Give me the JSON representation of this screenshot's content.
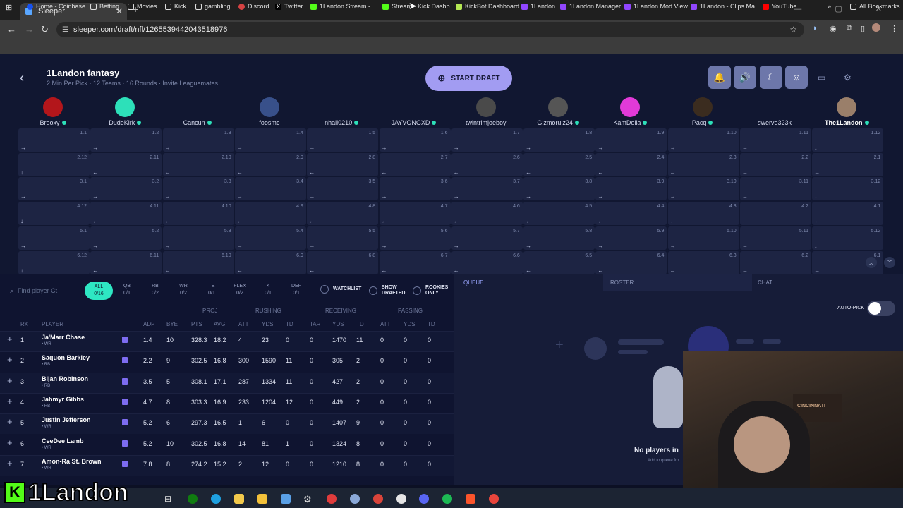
{
  "browser": {
    "tab_title": "Sleeper",
    "url": "sleeper.com/draft/nfl/1265539442043518976",
    "bookmarks": [
      "Home - Coinbase",
      "Betting",
      "Movies",
      "Kick",
      "gambling",
      "Discord",
      "Twitter",
      "1Landon Stream -...",
      "Stream - Kick Dashb...",
      "KickBot Dashboard",
      "1Landon",
      "1Landon Manager",
      "1Landon Mod View",
      "1Landon - Clips Ma...",
      "YouTube"
    ],
    "all_bookmarks": "All Bookmarks"
  },
  "header": {
    "league_name": "1Landon fantasy",
    "league_sub": "2 Min Per Pick · 12 Teams · 16 Rounds · Invite Leaguemates",
    "start_draft": "START DRAFT"
  },
  "teams": [
    "Brooxy",
    "DudeKirk",
    "Cancun",
    "foosmc",
    "nhall0210",
    "JAYVONGXD",
    "twintrimjoeboy",
    "Gizmorulz24",
    "KamDolla",
    "Pacq",
    "swervo323k",
    "The1Landon"
  ],
  "picks": [
    [
      "1.1",
      "1.2",
      "1.3",
      "1.4",
      "1.5",
      "1.6",
      "1.7",
      "1.8",
      "1.9",
      "1.10",
      "1.11",
      "1.12"
    ],
    [
      "2.12",
      "2.11",
      "2.10",
      "2.9",
      "2.8",
      "2.7",
      "2.6",
      "2.5",
      "2.4",
      "2.3",
      "2.2",
      "2.1"
    ],
    [
      "3.1",
      "3.2",
      "3.3",
      "3.4",
      "3.5",
      "3.6",
      "3.7",
      "3.8",
      "3.9",
      "3.10",
      "3.11",
      "3.12"
    ],
    [
      "4.12",
      "4.11",
      "4.10",
      "4.9",
      "4.8",
      "4.7",
      "4.6",
      "4.5",
      "4.4",
      "4.3",
      "4.2",
      "4.1"
    ],
    [
      "5.1",
      "5.2",
      "5.3",
      "5.4",
      "5.5",
      "5.6",
      "5.7",
      "5.8",
      "5.9",
      "5.10",
      "5.11",
      "5.12"
    ],
    [
      "6.12",
      "6.11",
      "6.10",
      "6.9",
      "6.8",
      "6.7",
      "6.6",
      "6.5",
      "6.4",
      "6.3",
      "6.2",
      "6.1"
    ]
  ],
  "players_panel": {
    "search_placeholder": "Find player Ct",
    "filters": [
      {
        "label": "ALL",
        "count": "0/16"
      },
      {
        "label": "QB",
        "count": "0/1"
      },
      {
        "label": "RB",
        "count": "0/2"
      },
      {
        "label": "WR",
        "count": "0/2"
      },
      {
        "label": "TE",
        "count": "0/1"
      },
      {
        "label": "FLEX",
        "count": "0/2"
      },
      {
        "label": "K",
        "count": "0/1"
      },
      {
        "label": "DEF",
        "count": "0/1"
      }
    ],
    "watchlist": "WATCHLIST",
    "show_drafted": "SHOW DRAFTED",
    "rookies_only": "ROOKIES ONLY",
    "groups": {
      "proj": "PROJ",
      "rushing": "RUSHING",
      "receiving": "RECEIVING",
      "passing": "PASSING"
    },
    "columns": [
      "RK",
      "PLAYER",
      "ADP",
      "BYE",
      "PTS",
      "AVG",
      "ATT",
      "YDS",
      "TD",
      "TAR",
      "YDS",
      "TD",
      "ATT",
      "YDS",
      "TD"
    ],
    "rows": [
      {
        "rk": "1",
        "name": "Ja'Marr Chase",
        "pos": "• WR",
        "adp": "1.4",
        "bye": "10",
        "pts": "328.3",
        "avg": "18.2",
        "ratt": "4",
        "ryds": "23",
        "rtd": "0",
        "tar": "0",
        "cyds": "1470",
        "ctd": "11",
        "patt": "0",
        "pyds": "0",
        "ptd": "0"
      },
      {
        "rk": "2",
        "name": "Saquon Barkley",
        "pos": "• RB",
        "adp": "2.2",
        "bye": "9",
        "pts": "302.5",
        "avg": "16.8",
        "ratt": "300",
        "ryds": "1590",
        "rtd": "11",
        "tar": "0",
        "cyds": "305",
        "ctd": "2",
        "patt": "0",
        "pyds": "0",
        "ptd": "0"
      },
      {
        "rk": "3",
        "name": "Bijan Robinson",
        "pos": "• RB",
        "adp": "3.5",
        "bye": "5",
        "pts": "308.1",
        "avg": "17.1",
        "ratt": "287",
        "ryds": "1334",
        "rtd": "11",
        "tar": "0",
        "cyds": "427",
        "ctd": "2",
        "patt": "0",
        "pyds": "0",
        "ptd": "0"
      },
      {
        "rk": "4",
        "name": "Jahmyr Gibbs",
        "pos": "• RB",
        "adp": "4.7",
        "bye": "8",
        "pts": "303.3",
        "avg": "16.9",
        "ratt": "233",
        "ryds": "1204",
        "rtd": "12",
        "tar": "0",
        "cyds": "449",
        "ctd": "2",
        "patt": "0",
        "pyds": "0",
        "ptd": "0"
      },
      {
        "rk": "5",
        "name": "Justin Jefferson",
        "pos": "• WR",
        "adp": "5.2",
        "bye": "6",
        "pts": "297.3",
        "avg": "16.5",
        "ratt": "1",
        "ryds": "6",
        "rtd": "0",
        "tar": "0",
        "cyds": "1407",
        "ctd": "9",
        "patt": "0",
        "pyds": "0",
        "ptd": "0"
      },
      {
        "rk": "6",
        "name": "CeeDee Lamb",
        "pos": "• WR",
        "adp": "5.2",
        "bye": "10",
        "pts": "302.5",
        "avg": "16.8",
        "ratt": "14",
        "ryds": "81",
        "rtd": "1",
        "tar": "0",
        "cyds": "1324",
        "ctd": "8",
        "patt": "0",
        "pyds": "0",
        "ptd": "0"
      },
      {
        "rk": "7",
        "name": "Amon-Ra St. Brown",
        "pos": "• WR",
        "adp": "7.8",
        "bye": "8",
        "pts": "274.2",
        "avg": "15.2",
        "ratt": "2",
        "ryds": "12",
        "rtd": "0",
        "tar": "0",
        "cyds": "1210",
        "ctd": "8",
        "patt": "0",
        "pyds": "0",
        "ptd": "0"
      }
    ]
  },
  "side_panel": {
    "tabs": [
      "QUEUE",
      "ROSTER",
      "CHAT"
    ],
    "auto_pick": "AUTO-PICK",
    "empty_title": "No players in",
    "empty_sub": "Add to queue fro"
  },
  "overlay": {
    "brand": "1Landon",
    "poster_text": "CINCINNATI"
  },
  "colors": {
    "accent": "#2ee7c3",
    "start_button": "#a29cf2",
    "bg": "#111731",
    "cell": "#1d2443"
  }
}
